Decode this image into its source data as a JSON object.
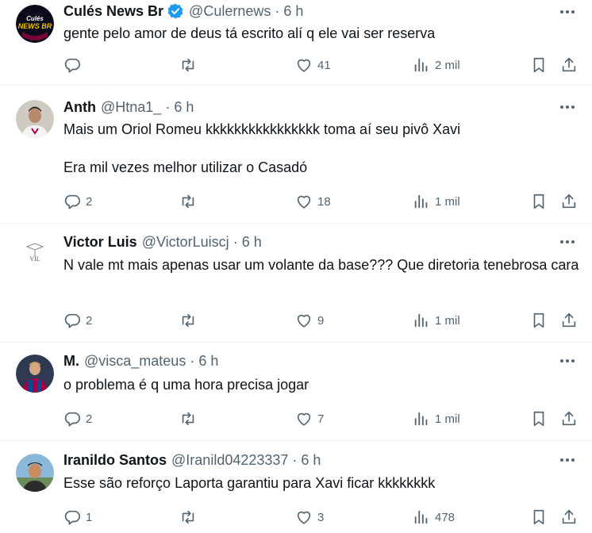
{
  "tweets": [
    {
      "name": "Culés News Br",
      "verified": true,
      "handle": "@Culernews",
      "time": "6 h",
      "avatar_text": "CULÉS NEWS BR",
      "paragraphs": [
        "gente pelo amor de deus tá escrito alí q ele vai ser reserva"
      ],
      "replies": "",
      "retweets": "",
      "likes": "41",
      "views": "2 mil"
    },
    {
      "name": "Anth",
      "verified": false,
      "handle": "@Htna1_",
      "time": "6 h",
      "paragraphs": [
        "Mais um Oriol Romeu kkkkkkkkkkkkkkkk toma aí seu pivô Xavi",
        "Era mil vezes melhor utilizar o Casadó"
      ],
      "replies": "2",
      "retweets": "",
      "likes": "18",
      "views": "1 mil"
    },
    {
      "name": "Victor Luis",
      "verified": false,
      "handle": "@VictorLuiscj",
      "time": "6 h",
      "avatar_text": "VIL",
      "paragraphs": [
        "N vale mt mais apenas usar um volante da base??? Que diretoria tenebrosa cara"
      ],
      "replies": "2",
      "retweets": "",
      "likes": "9",
      "views": "1 mil"
    },
    {
      "name": "M.",
      "verified": false,
      "handle": "@visca_mateus",
      "time": "6 h",
      "paragraphs": [
        "o problema é q uma hora precisa jogar"
      ],
      "replies": "2",
      "retweets": "",
      "likes": "7",
      "views": "1 mil"
    },
    {
      "name": "Iranildo Santos",
      "verified": false,
      "handle": "@Iranild04223337",
      "time": "6 h",
      "paragraphs": [
        "Esse são reforço Laporta garantiu para Xavi ficar  kkkkkkkk"
      ],
      "replies": "1",
      "retweets": "",
      "likes": "3",
      "views": "478"
    }
  ],
  "colors": {
    "text": "#0f1419",
    "secondary": "#536471",
    "verified": "#1d9bf0",
    "divider": "#eff3f4"
  }
}
